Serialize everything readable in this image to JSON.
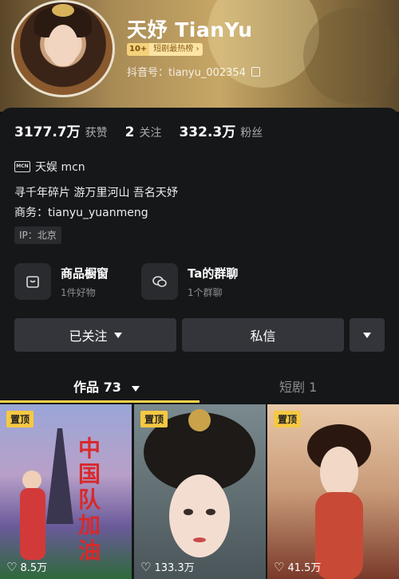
{
  "profile": {
    "name": "天妤 TianYu",
    "badge_level": "10+",
    "badge_text": "短剧最热榜 ›",
    "douyin_id": "抖音号：tianyu_002354"
  },
  "stats": [
    {
      "value": "3177.7万",
      "label": "获赞"
    },
    {
      "value": "2",
      "label": "关注"
    },
    {
      "value": "332.3万",
      "label": "粉丝"
    }
  ],
  "mcn": {
    "icon_text": "MCN",
    "label": "天娱 mcn"
  },
  "bio": "寻千年碎片 游万里河山 吾名天妤",
  "business": "商务：tianyu_yuanmeng",
  "ip": "IP：北京",
  "features": [
    {
      "title": "商品橱窗",
      "subtitle": "1件好物"
    },
    {
      "title": "Ta的群聊",
      "subtitle": "1个群聊"
    }
  ],
  "actions": {
    "follow": "已关注",
    "message": "私信"
  },
  "tabs": [
    {
      "label": "作品 73"
    },
    {
      "label": "短剧 1"
    }
  ],
  "videos": [
    {
      "pin": "置顶",
      "likes": "8.5万",
      "poster_text": "中国队加油"
    },
    {
      "pin": "置顶",
      "likes": "133.3万"
    },
    {
      "pin": "置顶",
      "likes": "41.5万"
    }
  ],
  "colors": {
    "accent": "#fbd44a",
    "background": "#161719",
    "button": "#34353a"
  }
}
